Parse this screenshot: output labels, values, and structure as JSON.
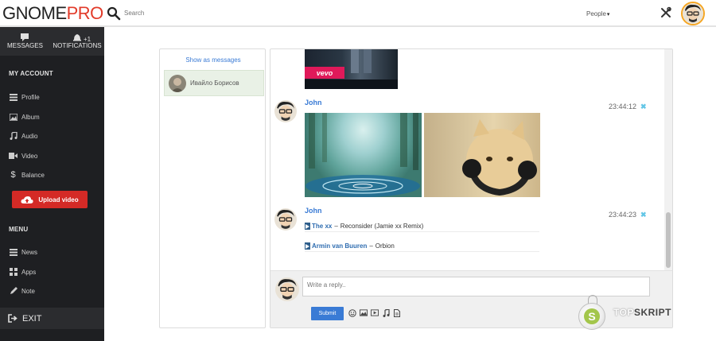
{
  "header": {
    "logo_part1": "GNOME",
    "logo_part2": "PRO",
    "search_placeholder": "Search",
    "people_label": "People",
    "caret": "▾"
  },
  "sidebar": {
    "top": [
      {
        "label": "MESSAGES",
        "icon": "chat-icon"
      },
      {
        "label": "NOTIFICATIONS",
        "icon": "bell-icon",
        "badge": "+1"
      }
    ],
    "my_account_title": "MY ACCOUNT",
    "account_items": [
      {
        "label": "Profile",
        "icon": "list-icon"
      },
      {
        "label": "Album",
        "icon": "image-icon"
      },
      {
        "label": "Audio",
        "icon": "music-icon"
      },
      {
        "label": "Video",
        "icon": "video-icon"
      },
      {
        "label": "Balance",
        "icon": "dollar-icon"
      }
    ],
    "upload_label": "Upload video",
    "menu_title": "MENU",
    "menu_items": [
      {
        "label": "News",
        "icon": "list-icon"
      },
      {
        "label": "Apps",
        "icon": "grid-icon"
      },
      {
        "label": "Note",
        "icon": "pencil-icon"
      }
    ],
    "exit_label": "EXIT"
  },
  "conversations": {
    "show_as_messages": "Show as messages",
    "items": [
      {
        "name": "Ивайло Борисов"
      }
    ]
  },
  "thread": {
    "vevo_label": "vevo",
    "messages": [
      {
        "author": "John",
        "time": "23:44:12",
        "close": "✖"
      },
      {
        "author": "John",
        "time": "23:44:23",
        "close": "✖"
      }
    ],
    "tracks": [
      {
        "artist": "The xx",
        "dash": "–",
        "title": "Reconsider (Jamie xx Remix)"
      },
      {
        "artist": "Armin van Buuren",
        "dash": "–",
        "title": "Orbion"
      }
    ]
  },
  "reply": {
    "placeholder": "Write a reply..",
    "submit_label": "Submit"
  },
  "watermark": {
    "part1": "TOP",
    "part2": "SKRIPT"
  },
  "colors": {
    "accent": "#3a7bd5",
    "logo_red": "#e23b2a",
    "upload_red": "#d42a26",
    "sidebar_bg": "#1e1f22"
  }
}
